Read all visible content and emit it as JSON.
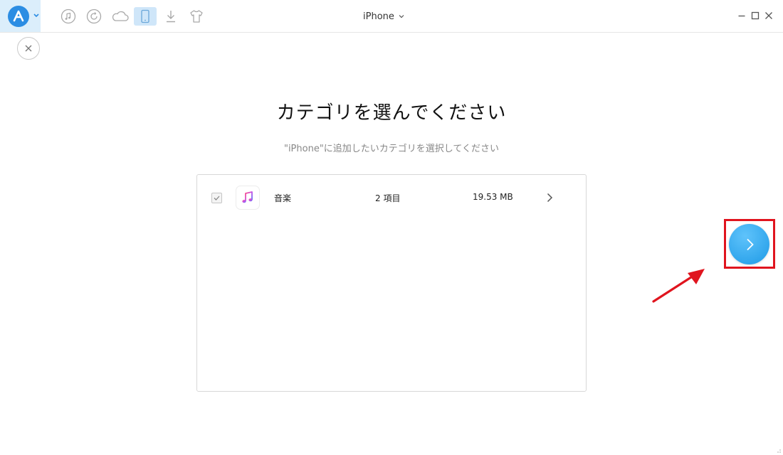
{
  "toolbar": {
    "device_name": "iPhone",
    "active_tool": "device-manager",
    "tools": [
      "music-icon",
      "history-icon",
      "cloud-icon",
      "phone-icon",
      "download-icon",
      "tshirt-icon"
    ]
  },
  "page": {
    "title": "カテゴリを選んでください",
    "subtitle": "\"iPhone\"に追加したいカテゴリを選択してください"
  },
  "categories": [
    {
      "name": "音楽",
      "count": "2 項目",
      "size": "19.53 MB",
      "checked": true,
      "icon": "apple-music-icon"
    }
  ],
  "colors": {
    "accent": "#2b8de3",
    "next_button": "#1e9ae6",
    "annotation_red": "#e0141e",
    "active_tool_bg": "#cfe6f9"
  }
}
